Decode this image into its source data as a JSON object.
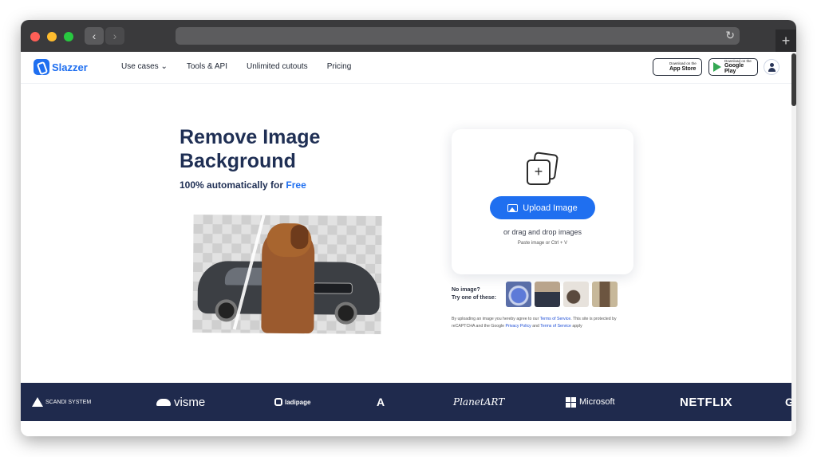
{
  "browser": {
    "back_icon": "chevron-left-icon",
    "forward_icon": "chevron-right-icon",
    "reload_icon": "reload-icon",
    "new_tab_icon": "plus-icon",
    "back_glyph": "‹",
    "forward_glyph": "›",
    "reload_glyph": "↻",
    "new_tab_glyph": "+"
  },
  "nav": {
    "logo_text": "Slazzer",
    "menu": [
      {
        "label": "Use cases ⌄"
      },
      {
        "label": "Tools & API"
      },
      {
        "label": "Unlimited cutouts"
      },
      {
        "label": "Pricing"
      }
    ],
    "app_store": {
      "small": "Download on the",
      "big": "App Store",
      "icon": "apple-icon",
      "glyph": ""
    },
    "google_play": {
      "small": "Download on the",
      "big": "Google Play",
      "icon": "google-play-icon"
    },
    "account_icon": "user-icon"
  },
  "hero": {
    "title": "Remove Image Background",
    "subtitle_prefix": "100% automatically for ",
    "subtitle_highlight": "Free"
  },
  "upload": {
    "button_label": "Upload Image",
    "drag_text": "or drag and drop images",
    "paste_text": "Paste image or Ctrl + V",
    "add_glyph": "+"
  },
  "samples": {
    "label_line1": "No image?",
    "label_line2": "Try one of these:"
  },
  "terms": {
    "part1": "By uploading an image you hereby agree to our ",
    "link1": "Terms of Service",
    "part2": ". This site is protected by reCAPTCHA and the Google ",
    "link2": "Privacy Policy",
    "part3": " and ",
    "link3": "Terms of Service",
    "part4": " apply"
  },
  "brands": {
    "scandi": "SCANDI SYSTEM",
    "visme": "visme",
    "ladipage": "ladipage",
    "arrow": "A",
    "planet": "PlanetART",
    "microsoft": "Microsoft",
    "netflix": "NETFLIX",
    "partial": "G"
  },
  "colors": {
    "accent": "#1f6ff0",
    "heading": "#1f2f54",
    "band": "#1f2a4d"
  }
}
